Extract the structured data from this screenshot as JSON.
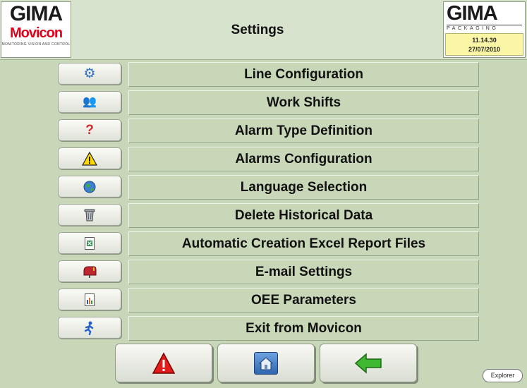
{
  "header": {
    "title": "Settings",
    "logo_left": {
      "brand": "GIMA",
      "product": "Movicon",
      "tagline": "MONITORING VISION AND CONTROL"
    },
    "logo_right": {
      "brand": "GIMA",
      "sub": "PACKAGING"
    },
    "time": "11.14.30",
    "date": "27/07/2010"
  },
  "menu": [
    {
      "label": "Line Configuration",
      "icon": "gear-icon"
    },
    {
      "label": "Work Shifts",
      "icon": "people-icon"
    },
    {
      "label": "Alarm Type Definition",
      "icon": "question-icon"
    },
    {
      "label": "Alarms Configuration",
      "icon": "warning-icon"
    },
    {
      "label": "Language Selection",
      "icon": "globe-icon"
    },
    {
      "label": "Delete Historical Data",
      "icon": "trash-icon"
    },
    {
      "label": "Automatic Creation Excel Report Files",
      "icon": "excel-icon"
    },
    {
      "label": "E-mail Settings",
      "icon": "mailbox-icon"
    },
    {
      "label": "OEE Parameters",
      "icon": "chart-icon"
    },
    {
      "label": "Exit from Movicon",
      "icon": "running-man-icon"
    }
  ],
  "bottom_bar": [
    {
      "name": "alarms-button",
      "icon": "alarm-triangle-icon"
    },
    {
      "name": "home-button",
      "icon": "home-icon"
    },
    {
      "name": "back-button",
      "icon": "back-arrow-icon"
    }
  ],
  "explorer": {
    "label": "Explorer"
  },
  "colors": {
    "background": "#c8d7b8",
    "header": "#d7e3cc",
    "accent_red": "#e2001a",
    "date_box": "#fbf6a6"
  }
}
